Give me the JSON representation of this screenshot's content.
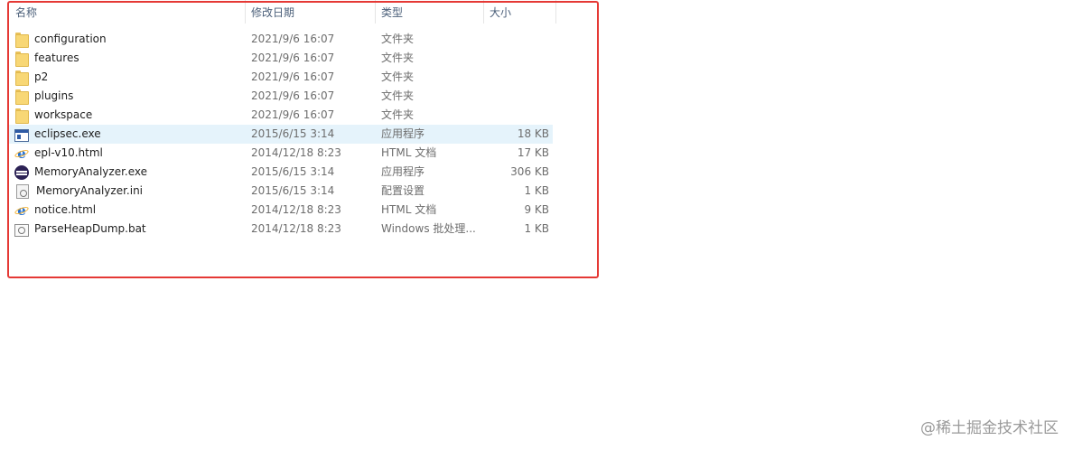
{
  "columns": {
    "name": "名称",
    "date": "修改日期",
    "type": "类型",
    "size": "大小"
  },
  "files": [
    {
      "name": "configuration",
      "date": "2021/9/6 16:07",
      "type": "文件夹",
      "size": "",
      "icon": "folder-icon"
    },
    {
      "name": "features",
      "date": "2021/9/6 16:07",
      "type": "文件夹",
      "size": "",
      "icon": "folder-icon"
    },
    {
      "name": "p2",
      "date": "2021/9/6 16:07",
      "type": "文件夹",
      "size": "",
      "icon": "folder-icon"
    },
    {
      "name": "plugins",
      "date": "2021/9/6 16:07",
      "type": "文件夹",
      "size": "",
      "icon": "folder-icon"
    },
    {
      "name": "workspace",
      "date": "2021/9/6 16:07",
      "type": "文件夹",
      "size": "",
      "icon": "folder-icon"
    },
    {
      "name": "eclipsec.exe",
      "date": "2015/6/15 3:14",
      "type": "应用程序",
      "size": "18 KB",
      "icon": "exe-icon",
      "selected": true
    },
    {
      "name": "epl-v10.html",
      "date": "2014/12/18 8:23",
      "type": "HTML 文档",
      "size": "17 KB",
      "icon": "ie-html-icon"
    },
    {
      "name": "MemoryAnalyzer.exe",
      "date": "2015/6/15 3:14",
      "type": "应用程序",
      "size": "306 KB",
      "icon": "eclipse-icon"
    },
    {
      "name": "MemoryAnalyzer.ini",
      "date": "2015/6/15 3:14",
      "type": "配置设置",
      "size": "1 KB",
      "icon": "ini-settings-icon"
    },
    {
      "name": "notice.html",
      "date": "2014/12/18 8:23",
      "type": "HTML 文档",
      "size": "9 KB",
      "icon": "ie-html-icon"
    },
    {
      "name": "ParseHeapDump.bat",
      "date": "2014/12/18 8:23",
      "type": "Windows 批处理...",
      "size": "1 KB",
      "icon": "bat-icon"
    }
  ],
  "highlight_color": "#e53935",
  "selection_color": "#e5f3fb",
  "watermark": "@稀土掘金技术社区"
}
